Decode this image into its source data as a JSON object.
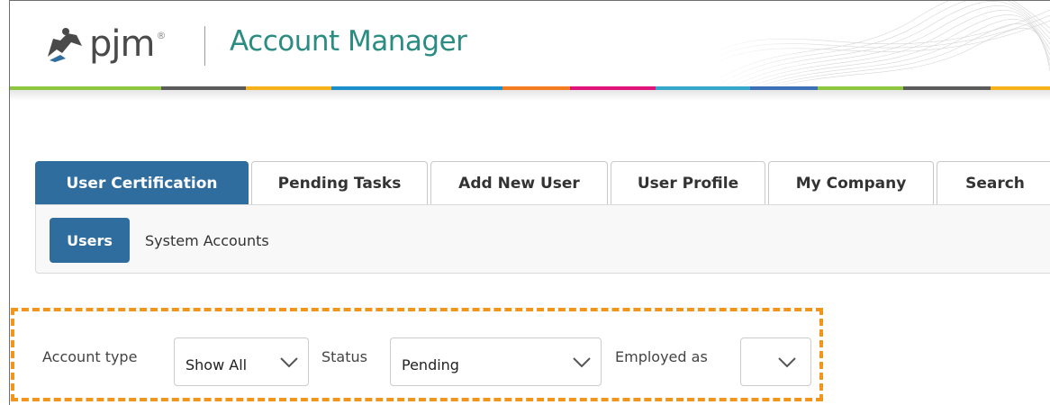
{
  "header": {
    "logo_text": "pjm",
    "logo_tm": "®",
    "app_title": "Account Manager"
  },
  "tabs": [
    {
      "label": "User Certification",
      "active": true
    },
    {
      "label": "Pending Tasks",
      "active": false
    },
    {
      "label": "Add New User",
      "active": false
    },
    {
      "label": "User Profile",
      "active": false
    },
    {
      "label": "My Company",
      "active": false
    },
    {
      "label": "Search",
      "active": false
    }
  ],
  "subnav": {
    "users_label": "Users",
    "system_accounts_label": "System Accounts"
  },
  "filters": {
    "account_type_label": "Account type",
    "account_type_value": "Show All",
    "status_label": "Status",
    "status_value": "Pending",
    "employed_as_label": "Employed as",
    "employed_as_value": ""
  },
  "colors": {
    "accent_blue": "#2f6d9e",
    "title_teal": "#2a8c82",
    "highlight_orange": "#f0961c",
    "stripe": [
      "#8dc63f",
      "#5b5b5b",
      "#f5b21a",
      "#1a8fc9",
      "#f47b20",
      "#e0137b",
      "#35a8c9",
      "#3b6fb6",
      "#8dc63f",
      "#5b5b5b",
      "#f5b21a"
    ]
  },
  "icons": {
    "logo": "pjm-figure-icon",
    "dropdown": "chevron-down-icon"
  }
}
